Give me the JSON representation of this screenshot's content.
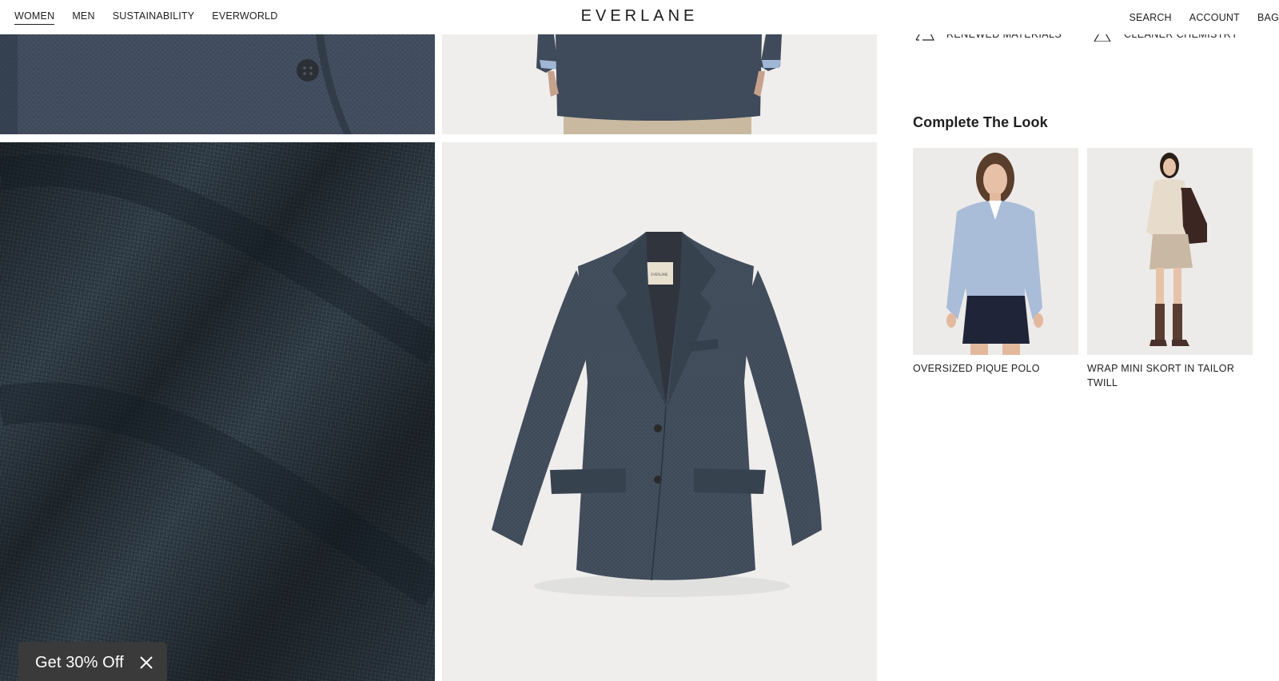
{
  "header": {
    "logo": "EVERLANE",
    "nav_left": [
      {
        "label": "WOMEN",
        "active": true
      },
      {
        "label": "MEN",
        "active": false
      },
      {
        "label": "SUSTAINABILITY",
        "active": false
      },
      {
        "label": "EVERWORLD",
        "active": false
      }
    ],
    "nav_right": [
      "SEARCH",
      "ACCOUNT",
      "BAG"
    ]
  },
  "features": [
    {
      "icon": "recycle-icon",
      "label": "RENEWED MATERIALS"
    },
    {
      "icon": "flask-icon",
      "label": "CLEANER CHEMISTRY"
    }
  ],
  "complete_the_look": {
    "title": "Complete The Look",
    "products": [
      {
        "name": "OVERSIZED PIQUE POLO"
      },
      {
        "name": "WRAP MINI SKORT IN TAILOR TWILL"
      }
    ]
  },
  "promo": {
    "text": "Get 30% Off",
    "close_icon": "close-icon"
  },
  "colors": {
    "fabric": "#2b3742",
    "blazer": "#3f4a58",
    "tile_background": "#efeeec",
    "promo_background": "#3a3a3a",
    "polo": "#a9bcd8",
    "skirt_navy": "#1f2438"
  }
}
